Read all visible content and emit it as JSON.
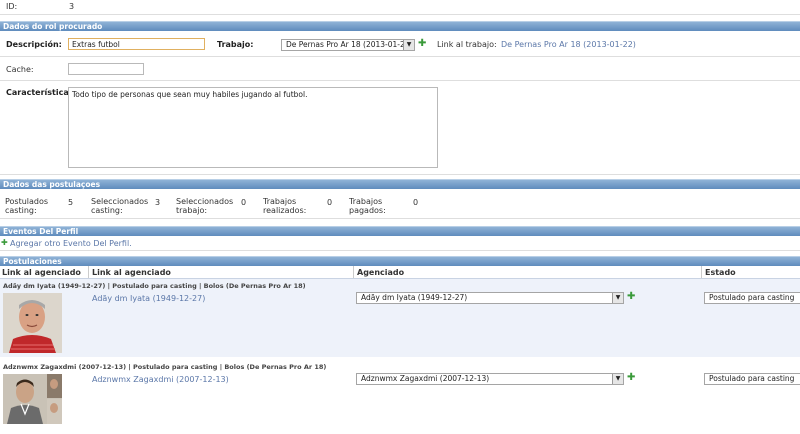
{
  "id_row": {
    "label": "ID:",
    "value": "3"
  },
  "sections": {
    "role": "Dados do rol procurado",
    "applications": "Dados das postulaçoes",
    "events": "Eventos Del Perfil",
    "postulations": "Postulaciones"
  },
  "role": {
    "descripcion_label": "Descripción:",
    "descripcion_value": "Extras futbol",
    "trabajo_label": "Trabajo:",
    "trabajo_selected": "De Pernas Pro Ar 18 (2013-01-22)",
    "link_label": "Link al trabajo:",
    "link_value": "De Pernas Pro Ar 18 (2013-01-22)",
    "cache_label": "Cache:",
    "cache_value": "",
    "caracteristicas_label": "Características:",
    "caracteristicas_value": "Todo tipo de personas que sean muy habiles jugando al futbol."
  },
  "stats": [
    {
      "label1": "Postulados",
      "label2": "casting:",
      "value": "5"
    },
    {
      "label1": "Seleccionados",
      "label2": "casting:",
      "value": "3"
    },
    {
      "label1": "Seleccionados",
      "label2": "trabajo:",
      "value": "0"
    },
    {
      "label1": "Trabajos",
      "label2": "realizados:",
      "value": "0"
    },
    {
      "label1": "Trabajos",
      "label2": "pagados:",
      "value": "0"
    }
  ],
  "events": {
    "add_link": "Agregar otro Evento Del Perfil."
  },
  "table": {
    "headers": [
      "Link al agenciado",
      "Link al agenciado",
      "Agenciado",
      "Estado"
    ],
    "rows": [
      {
        "title": "Adãy dm Iyata (1949-12-27) | Postulado para casting | Bolos (De Pernas Pro Ar 18)",
        "link": "Adãy dm Iyata (1949-12-27)",
        "agenciado": "Adãy dm Iyata (1949-12-27)",
        "estado": "Postulado para casting"
      },
      {
        "title": "Adznwmx Zagaxdmi (2007-12-13) | Postulado para casting | Bolos (De Pernas Pro Ar 18)",
        "link": "Adznwmx Zagaxdmi (2007-12-13)",
        "agenciado": "Adznwmx Zagaxdmi (2007-12-13)",
        "estado": "Postulado para casting"
      }
    ]
  },
  "icons": {
    "add": "plus-icon",
    "dropdown": "chevron-down-icon"
  },
  "colors": {
    "band": "#6d96c4",
    "link": "#5b77a8",
    "row_bg": "#eef2fa",
    "add": "#3a9a3a"
  }
}
